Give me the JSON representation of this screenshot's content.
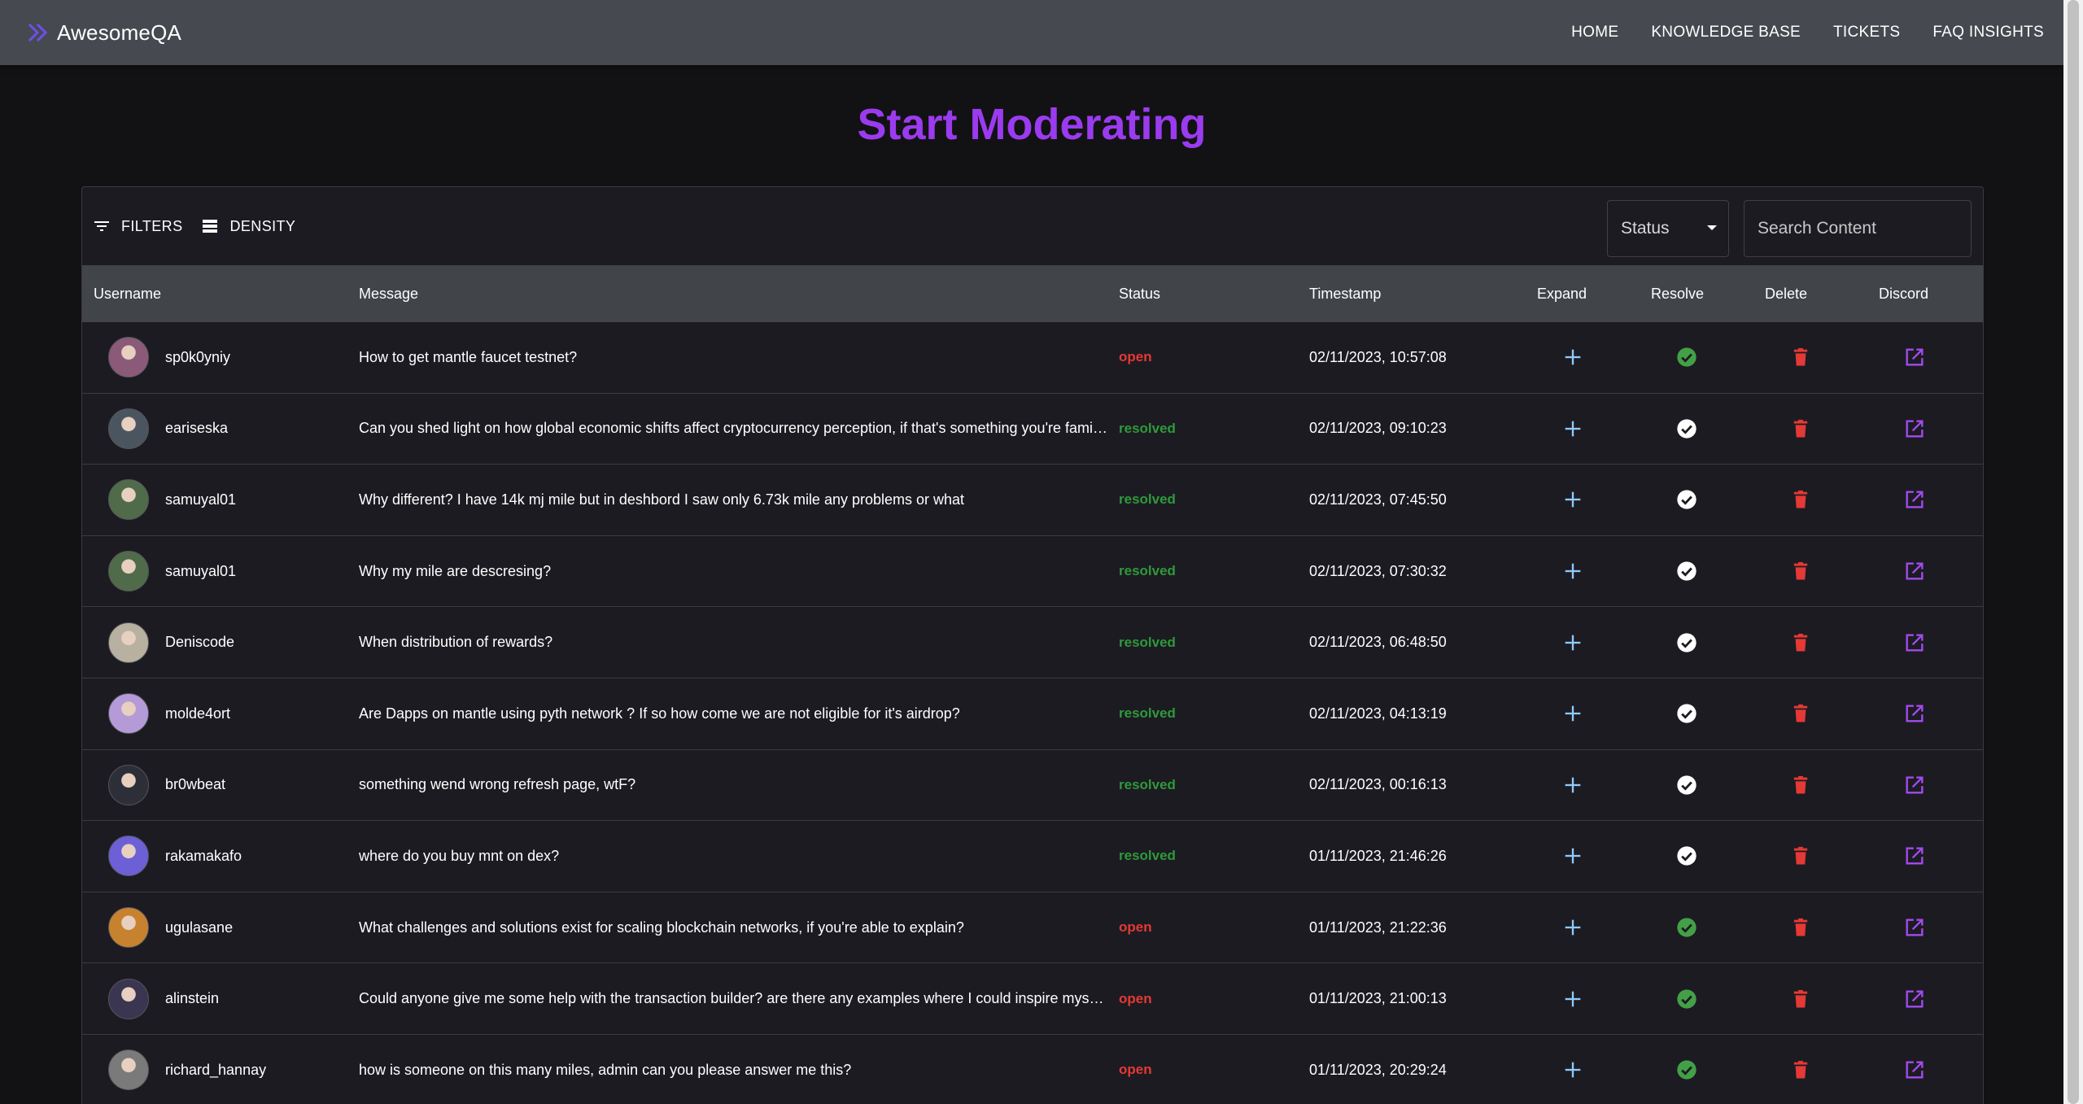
{
  "nav": {
    "brand": "AwesomeQA",
    "links": [
      "HOME",
      "KNOWLEDGE BASE",
      "TICKETS",
      "FAQ INSIGHTS"
    ]
  },
  "page": {
    "title": "Start Moderating"
  },
  "toolbar": {
    "filters_label": "FILTERS",
    "density_label": "DENSITY",
    "status_select_label": "Status",
    "search_placeholder": "Search Content"
  },
  "columns": {
    "username": "Username",
    "message": "Message",
    "status": "Status",
    "timestamp": "Timestamp",
    "expand": "Expand",
    "resolve": "Resolve",
    "delete": "Delete",
    "discord": "Discord"
  },
  "colors": {
    "accent": "#9b3bef",
    "open": "#e53935",
    "resolved": "#2e9a3a",
    "delete": "#e53935",
    "discord": "#a24bf0",
    "expand": "#90caf9",
    "resolve_open": "#43a047",
    "resolve_done": "#ffffff"
  },
  "rows": [
    {
      "username": "sp0k0yniy",
      "message": "How to get mantle faucet testnet?",
      "status": "open",
      "timestamp": "02/11/2023, 10:57:08",
      "avatar_color": "#8a5a78"
    },
    {
      "username": "eariseska",
      "message": "Can you shed light on how global economic shifts affect cryptocurrency perception, if that's something you're familiar with?",
      "status": "resolved",
      "timestamp": "02/11/2023, 09:10:23",
      "avatar_color": "#4a5560"
    },
    {
      "username": "samuyal01",
      "message": "Why different? I have 14k mj mile but in deshbord I saw only 6.73k mile any problems or what",
      "status": "resolved",
      "timestamp": "02/11/2023, 07:45:50",
      "avatar_color": "#4f6b4a"
    },
    {
      "username": "samuyal01",
      "message": "Why my mile are descresing?",
      "status": "resolved",
      "timestamp": "02/11/2023, 07:30:32",
      "avatar_color": "#4f6b4a"
    },
    {
      "username": "Deniscode",
      "message": "When distribution of rewards?",
      "status": "resolved",
      "timestamp": "02/11/2023, 06:48:50",
      "avatar_color": "#b8b0a0"
    },
    {
      "username": "molde4ort",
      "message": "Are Dapps on mantle using pyth network ? If so how come we are not eligible for it's airdrop?",
      "status": "resolved",
      "timestamp": "02/11/2023, 04:13:19",
      "avatar_color": "#b59ad8"
    },
    {
      "username": "br0wbeat",
      "message": "something wend wrong refresh page, wtF?",
      "status": "resolved",
      "timestamp": "02/11/2023, 00:16:13",
      "avatar_color": "#2c2f38"
    },
    {
      "username": "rakamakafo",
      "message": "where do you buy mnt on dex?",
      "status": "resolved",
      "timestamp": "01/11/2023, 21:46:26",
      "avatar_color": "#6d5fd6"
    },
    {
      "username": "ugulasane",
      "message": "What challenges and solutions exist for scaling blockchain networks, if you're able to explain?",
      "status": "open",
      "timestamp": "01/11/2023, 21:22:36",
      "avatar_color": "#c7822f"
    },
    {
      "username": "alinstein",
      "message": "Could anyone give me some help with the transaction builder? are there any examples where I could inspire myself from?",
      "status": "open",
      "timestamp": "01/11/2023, 21:00:13",
      "avatar_color": "#3a3550"
    },
    {
      "username": "richard_hannay",
      "message": "how is someone on this many miles, admin can you please answer me this?",
      "status": "open",
      "timestamp": "01/11/2023, 20:29:24",
      "avatar_color": "#7a7a7a"
    }
  ]
}
